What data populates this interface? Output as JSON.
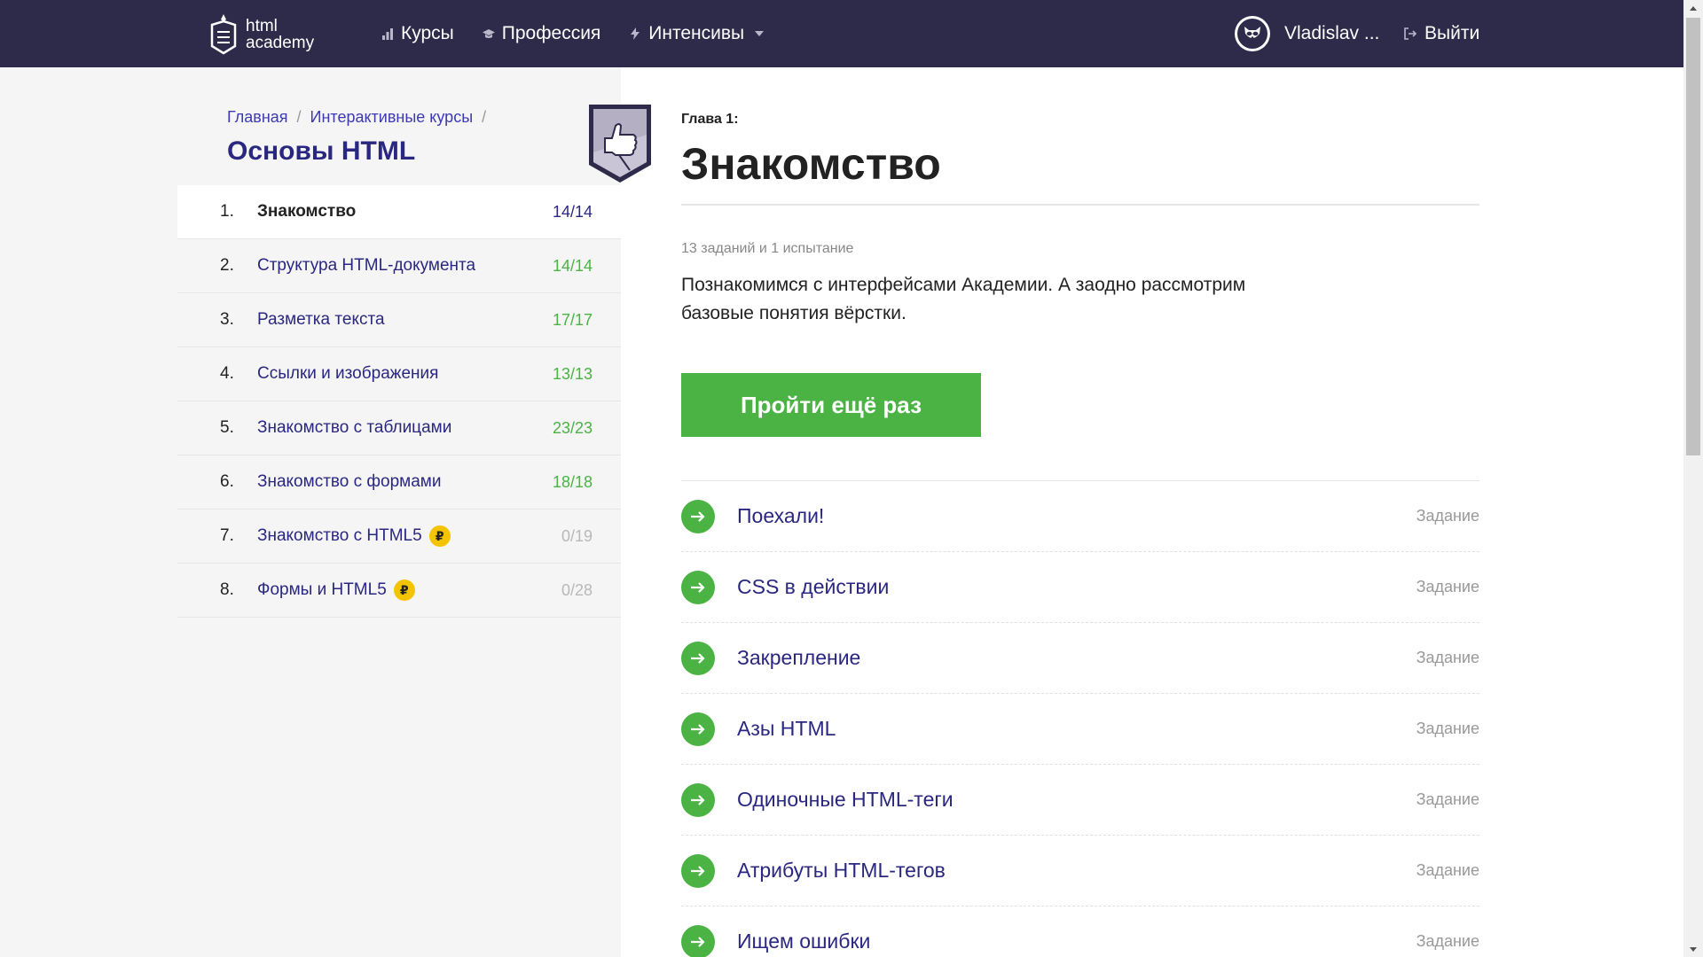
{
  "header": {
    "logo_line1": "html",
    "logo_line2": "academy",
    "nav": [
      {
        "label": "Курсы"
      },
      {
        "label": "Профессия"
      },
      {
        "label": "Интенсивы"
      }
    ],
    "user_name": "Vladislav ...",
    "logout_label": "Выйти"
  },
  "sidebar": {
    "breadcrumb": [
      {
        "label": "Главная"
      },
      {
        "label": "Интерактивные курсы"
      }
    ],
    "breadcrumb_sep": "/",
    "course_title": "Основы HTML",
    "chapters": [
      {
        "num": "1.",
        "title": "Знакомство",
        "count": "14/14",
        "active": true,
        "paid": false
      },
      {
        "num": "2.",
        "title": "Структура HTML-документа",
        "count": "14/14",
        "active": false,
        "paid": false
      },
      {
        "num": "3.",
        "title": "Разметка текста",
        "count": "17/17",
        "active": false,
        "paid": false
      },
      {
        "num": "4.",
        "title": "Ссылки и изображения",
        "count": "13/13",
        "active": false,
        "paid": false
      },
      {
        "num": "5.",
        "title": "Знакомство с таблицами",
        "count": "23/23",
        "active": false,
        "paid": false
      },
      {
        "num": "6.",
        "title": "Знакомство с формами",
        "count": "18/18",
        "active": false,
        "paid": false
      },
      {
        "num": "7.",
        "title": "Знакомство с HTML5",
        "count": "0/19",
        "active": false,
        "paid": true
      },
      {
        "num": "8.",
        "title": "Формы и HTML5",
        "count": "0/28",
        "active": false,
        "paid": true
      }
    ],
    "paid_badge": "₽"
  },
  "main": {
    "chapter_label": "Глава 1:",
    "chapter_title": "Знакомство",
    "subtitle": "13 заданий и 1 испытание",
    "description": "Познакомимся с интерфейсами Академии. А заодно рассмотрим базовые понятия вёрстки.",
    "cta_label": "Пройти ещё раз",
    "tasks": [
      {
        "title": "Поехали!",
        "type": "Задание"
      },
      {
        "title": "CSS в действии",
        "type": "Задание"
      },
      {
        "title": "Закрепление",
        "type": "Задание"
      },
      {
        "title": "Азы HTML",
        "type": "Задание"
      },
      {
        "title": "Одиночные HTML-теги",
        "type": "Задание"
      },
      {
        "title": "Атрибуты HTML-тегов",
        "type": "Задание"
      },
      {
        "title": "Ищем ошибки",
        "type": "Задание"
      }
    ]
  },
  "colors": {
    "header_bg": "#2d2a4a",
    "accent_green": "#4ab344",
    "link_blue": "#2a2780",
    "paid_yellow": "#f5c400"
  },
  "icons": {
    "nav": [
      "bars-icon",
      "graduation-cap-icon",
      "lightning-icon",
      "chevron-down-icon"
    ],
    "task": "arrow-right-icon",
    "logout": "logout-icon",
    "avatar": "raccoon-avatar-icon",
    "badge": "thumbs-up-shield-icon"
  }
}
